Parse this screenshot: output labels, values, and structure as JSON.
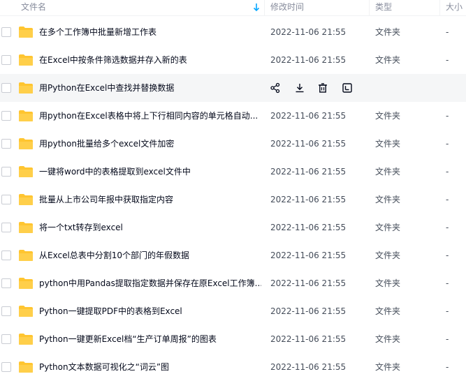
{
  "header": {
    "name_label": "文件名",
    "time_label": "修改时间",
    "type_label": "类型",
    "size_label": "大小"
  },
  "files": [
    {
      "name": "在多个工作簿中批量新增工作表",
      "time": "2022-11-06 21:55",
      "type": "文件夹",
      "size": "-"
    },
    {
      "name": "在Excel中按条件筛选数据并存入新的表",
      "time": "2022-11-06 21:55",
      "type": "文件夹",
      "size": "-"
    },
    {
      "name": "用Python在Excel中查找并替换数据",
      "time": "",
      "type": "",
      "size": "",
      "hover": true
    },
    {
      "name": "用python在Excel表格中将上下行相同内容的单元格自动...",
      "time": "2022-11-06 21:55",
      "type": "文件夹",
      "size": "-"
    },
    {
      "name": "用python批量给多个excel文件加密",
      "time": "2022-11-06 21:55",
      "type": "文件夹",
      "size": "-"
    },
    {
      "name": "一键将word中的表格提取到excel文件中",
      "time": "2022-11-06 21:55",
      "type": "文件夹",
      "size": "-"
    },
    {
      "name": "批量从上市公司年报中获取指定内容",
      "time": "2022-11-06 21:55",
      "type": "文件夹",
      "size": "-"
    },
    {
      "name": "将一个txt转存到excel",
      "time": "2022-11-06 21:55",
      "type": "文件夹",
      "size": "-"
    },
    {
      "name": "从Excel总表中分割10个部门的年假数据",
      "time": "2022-11-06 21:55",
      "type": "文件夹",
      "size": "-"
    },
    {
      "name": "python中用Pandas提取指定数据并保存在原Excel工作簿...",
      "time": "2022-11-06 21:55",
      "type": "文件夹",
      "size": "-"
    },
    {
      "name": "Python一键提取PDF中的表格到Excel",
      "time": "2022-11-06 21:55",
      "type": "文件夹",
      "size": "-"
    },
    {
      "name": "Python一键更新Excel档“生产订单周报”的图表",
      "time": "2022-11-06 21:55",
      "type": "文件夹",
      "size": "-"
    },
    {
      "name": "Python文本数据可视化之“词云”图",
      "time": "2022-11-06 21:55",
      "type": "文件夹",
      "size": "-"
    }
  ],
  "hover_actions": [
    "share-icon",
    "download-icon",
    "delete-icon",
    "more-icon"
  ],
  "colors": {
    "folder": "#ffc530",
    "accent": "#06a7ff",
    "hover_row": "#f5f6f7"
  }
}
